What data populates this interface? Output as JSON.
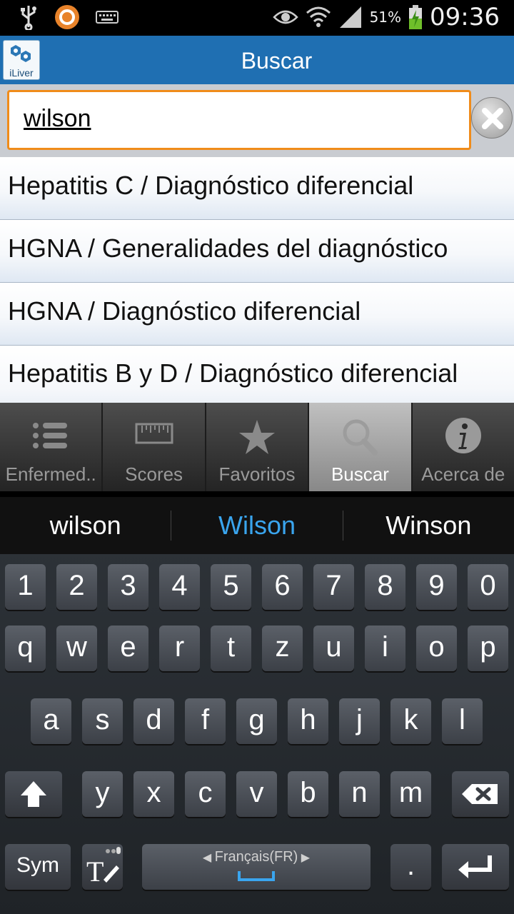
{
  "status_bar": {
    "battery": "51%",
    "time": "09:36",
    "icons": [
      "usb-icon",
      "app-notification-icon",
      "keyboard-icon",
      "eye-icon",
      "wifi-icon",
      "signal-icon",
      "battery-charging-icon"
    ]
  },
  "action_bar": {
    "app_logo_label": "iLiver",
    "title": "Buscar"
  },
  "search": {
    "value": "wilson",
    "clear_icon": "clear-icon",
    "accent_color": "#f08c1a"
  },
  "results": [
    {
      "label": "Hepatitis C / Diagnóstico diferencial"
    },
    {
      "label": "HGNA / Generalidades del diagnóstico"
    },
    {
      "label": "HGNA / Diagnóstico diferencial"
    },
    {
      "label": "Hepatitis B y D  / Diagnóstico diferencial"
    }
  ],
  "tabs": [
    {
      "label": "Enfermed..",
      "icon": "list-icon",
      "active": false
    },
    {
      "label": "Scores",
      "icon": "ruler-icon",
      "active": false
    },
    {
      "label": "Favoritos",
      "icon": "star-icon",
      "active": false
    },
    {
      "label": "Buscar",
      "icon": "search-icon",
      "active": true
    },
    {
      "label": "Acerca de",
      "icon": "info-icon",
      "active": false
    }
  ],
  "keyboard": {
    "suggestions": [
      "wilson",
      "Wilson",
      "Winson"
    ],
    "number_row": [
      "1",
      "2",
      "3",
      "4",
      "5",
      "6",
      "7",
      "8",
      "9",
      "0"
    ],
    "row1": [
      "q",
      "w",
      "e",
      "r",
      "t",
      "z",
      "u",
      "i",
      "o",
      "p"
    ],
    "row2": [
      "a",
      "s",
      "d",
      "f",
      "g",
      "h",
      "j",
      "k",
      "l"
    ],
    "row3": [
      "y",
      "x",
      "c",
      "v",
      "b",
      "n",
      "m"
    ],
    "sym_label": "Sym",
    "language_label": "Français(FR)",
    "period_label": ".",
    "highlight_color": "#3aa5ee"
  }
}
